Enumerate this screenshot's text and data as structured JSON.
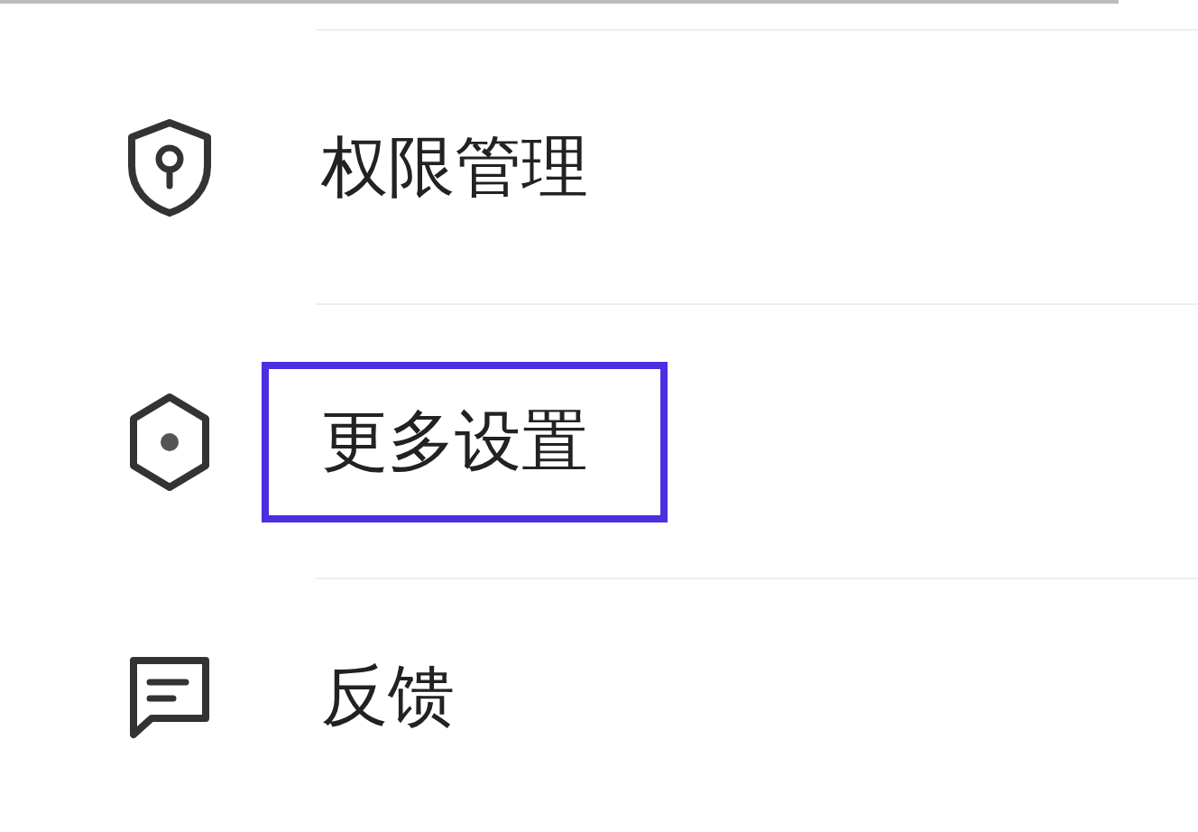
{
  "menu": {
    "items": [
      {
        "label": "权限管理",
        "highlighted": false
      },
      {
        "label": "更多设置",
        "highlighted": true
      },
      {
        "label": "反馈",
        "highlighted": false
      }
    ]
  }
}
